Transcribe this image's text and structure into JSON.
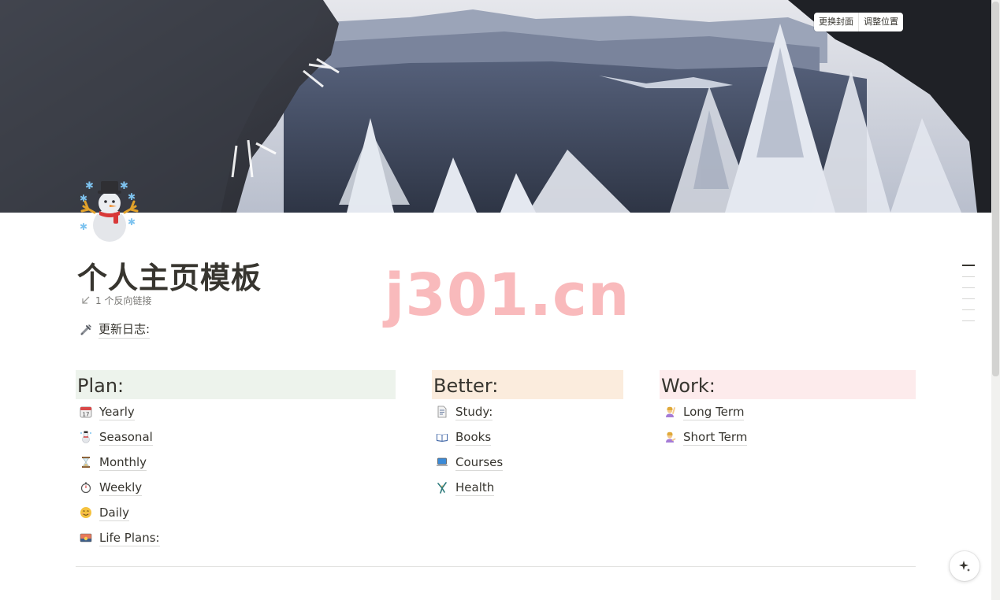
{
  "cover": {
    "change_label": "更换封面",
    "reposition_label": "调整位置"
  },
  "page": {
    "icon": "snowman-icon",
    "title": "个人主页模板",
    "backlinks": "1 个反向链接",
    "log_link": "更新日志:"
  },
  "watermark": "j301.cn",
  "columns": [
    {
      "heading": "Plan:",
      "bg": "#edf3ec",
      "items": [
        {
          "label": "Yearly",
          "icon": "calendar-icon"
        },
        {
          "label": "Seasonal",
          "icon": "snowman-icon"
        },
        {
          "label": "Monthly",
          "icon": "hourglass-icon"
        },
        {
          "label": "Weekly",
          "icon": "stopwatch-icon"
        },
        {
          "label": "Daily",
          "icon": "smiley-icon"
        },
        {
          "label": "Life Plans:",
          "icon": "sunrise-icon"
        }
      ]
    },
    {
      "heading": "Better:",
      "bg": "#fbecdd",
      "items": [
        {
          "label": "Study:",
          "icon": "document-icon"
        },
        {
          "label": "Books",
          "icon": "open-book-icon"
        },
        {
          "label": "Courses",
          "icon": "laptop-icon"
        },
        {
          "label": "Health",
          "icon": "cartwheel-icon"
        }
      ]
    },
    {
      "heading": "Work:",
      "bg": "#fdebec",
      "items": [
        {
          "label": "Long Term",
          "icon": "person-raising-hand-icon"
        },
        {
          "label": "Short Term",
          "icon": "person-tipping-hand-icon"
        }
      ]
    }
  ]
}
